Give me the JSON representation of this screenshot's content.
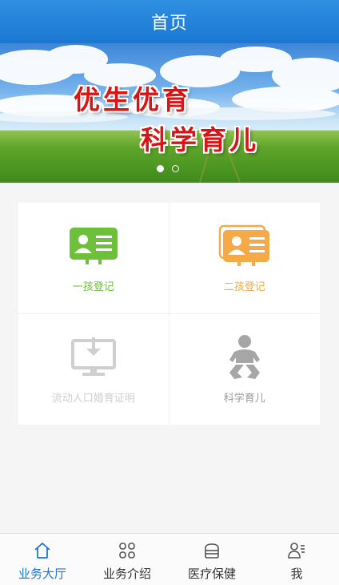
{
  "header": {
    "title": "首页"
  },
  "banner": {
    "line1": "优生优育",
    "line2": "科学育儿",
    "slide_count": 2,
    "active_slide": 1
  },
  "grid": {
    "items": [
      {
        "label": "一孩登记",
        "icon": "id-card-icon",
        "color": "#6ebf3a"
      },
      {
        "label": "二孩登记",
        "icon": "stacked-id-card-icon",
        "color": "#f5a947"
      },
      {
        "label": "流动人口婚育证明",
        "icon": "monitor-download-icon",
        "color": "#cfcfcf"
      },
      {
        "label": "科学育儿",
        "icon": "baby-icon",
        "color": "#9a9a9a"
      }
    ]
  },
  "tabbar": {
    "active": 0,
    "accent": "#1a78d2",
    "tabs": [
      {
        "label": "业务大厅",
        "icon": "home-icon"
      },
      {
        "label": "业务介绍",
        "icon": "grid-icon"
      },
      {
        "label": "医疗保健",
        "icon": "medicine-box-icon"
      },
      {
        "label": "我",
        "icon": "profile-icon"
      }
    ]
  }
}
